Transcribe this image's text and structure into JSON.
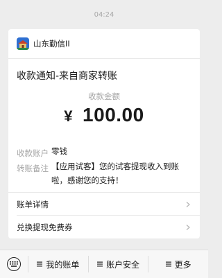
{
  "timestamp": "04:24",
  "card": {
    "merchant_name": "山东勤信II",
    "notice_title": "收款通知-来自商家转账",
    "amount_label": "收款金额",
    "currency_symbol": "¥",
    "amount": "100.00",
    "account_label": "收款账户",
    "account_value": "零钱",
    "remark_label": "转账备注",
    "remark_value": "【应用试客】您的试客提现收入到账啦，感谢您的支持！",
    "bill_details_label": "账单详情",
    "exchange_label": "兑换提现免费券"
  },
  "bottom_menu": {
    "keyboard_icon": "keyboard-icon",
    "items": [
      {
        "label": "我的账单",
        "icon": "menu-lines-icon"
      },
      {
        "label": "账户安全",
        "icon": "menu-lines-icon"
      },
      {
        "label": "更多",
        "icon": "menu-lines-icon"
      }
    ]
  },
  "colors": {
    "background": "#ededed",
    "card": "#ffffff",
    "muted_text": "#a6a6a6",
    "primary_text": "#1a1a1a"
  }
}
